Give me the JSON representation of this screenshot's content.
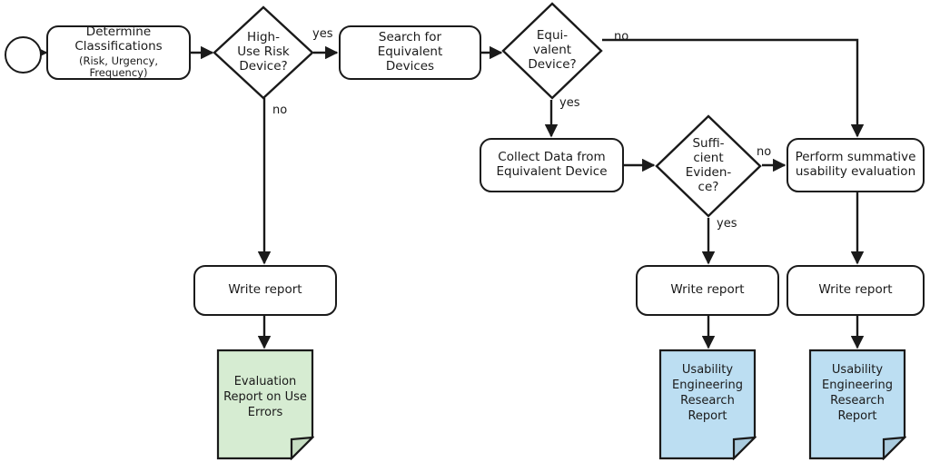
{
  "diagram": {
    "title": "Usability Engineering Process Flowchart",
    "background_color": "#ffffff",
    "stroke_color": "#1a1a1a",
    "document_fill_green": "#d6ecd2",
    "document_fill_blue": "#bcdef2",
    "process_fill": "#ffffff"
  },
  "nodes": {
    "start": {
      "type": "start-terminator",
      "label": ""
    },
    "determine_classifications": {
      "type": "process",
      "line1": "Determine",
      "line2": "Classifications",
      "line3": "(Risk, Urgency, Frequency)"
    },
    "high_use_risk_device": {
      "type": "decision",
      "line1": "High-",
      "line2": "Use Risk",
      "line3": "Device?"
    },
    "search_equivalent_devices": {
      "type": "process",
      "line1": "Search for Equivalent",
      "line2": "Devices"
    },
    "equivalent_device": {
      "type": "decision",
      "line1": "Equi-",
      "line2": "valent",
      "line3": "Device?"
    },
    "collect_data": {
      "type": "process",
      "line1": "Collect Data from",
      "line2": "Equivalent Device"
    },
    "sufficient_evidence": {
      "type": "decision",
      "line1": "Suffi-",
      "line2": "cient",
      "line3": "Eviden-",
      "line4": "ce?"
    },
    "perform_summative": {
      "type": "process",
      "line1": "Perform summative",
      "line2": "usability evaluation"
    },
    "write_report_left": {
      "type": "process",
      "line1": "Write report"
    },
    "write_report_middle": {
      "type": "process",
      "line1": "Write report"
    },
    "write_report_right": {
      "type": "process",
      "line1": "Write report"
    },
    "evaluation_report_doc": {
      "type": "document",
      "fill": "#d6ecd2",
      "line1": "Evaluation",
      "line2": "Report on Use",
      "line3": "Errors"
    },
    "uer_report_doc_middle": {
      "type": "document",
      "fill": "#bcdef2",
      "line1": "Usability",
      "line2": "Engineering",
      "line3": "Research",
      "line4": "Report"
    },
    "uer_report_doc_right": {
      "type": "document",
      "fill": "#bcdef2",
      "line1": "Usability",
      "line2": "Engineering",
      "line3": "Research",
      "line4": "Report"
    }
  },
  "edge_labels": {
    "high_risk_yes": "yes",
    "high_risk_no": "no",
    "equivalent_no": "no",
    "equivalent_yes": "yes",
    "sufficient_no": "no",
    "sufficient_yes": "yes"
  },
  "flow": {
    "type": "flowchart",
    "edges": [
      {
        "from": "start",
        "to": "determine_classifications",
        "label": ""
      },
      {
        "from": "determine_classifications",
        "to": "high_use_risk_device",
        "label": ""
      },
      {
        "from": "high_use_risk_device",
        "to": "search_equivalent_devices",
        "label": "yes"
      },
      {
        "from": "high_use_risk_device",
        "to": "write_report_left",
        "label": "no"
      },
      {
        "from": "search_equivalent_devices",
        "to": "equivalent_device",
        "label": ""
      },
      {
        "from": "equivalent_device",
        "to": "perform_summative",
        "label": "no"
      },
      {
        "from": "equivalent_device",
        "to": "collect_data",
        "label": "yes"
      },
      {
        "from": "collect_data",
        "to": "sufficient_evidence",
        "label": ""
      },
      {
        "from": "sufficient_evidence",
        "to": "perform_summative",
        "label": "no"
      },
      {
        "from": "sufficient_evidence",
        "to": "write_report_middle",
        "label": "yes"
      },
      {
        "from": "perform_summative",
        "to": "write_report_right",
        "label": ""
      },
      {
        "from": "write_report_left",
        "to": "evaluation_report_doc",
        "label": ""
      },
      {
        "from": "write_report_middle",
        "to": "uer_report_doc_middle",
        "label": ""
      },
      {
        "from": "write_report_right",
        "to": "uer_report_doc_right",
        "label": ""
      }
    ]
  }
}
